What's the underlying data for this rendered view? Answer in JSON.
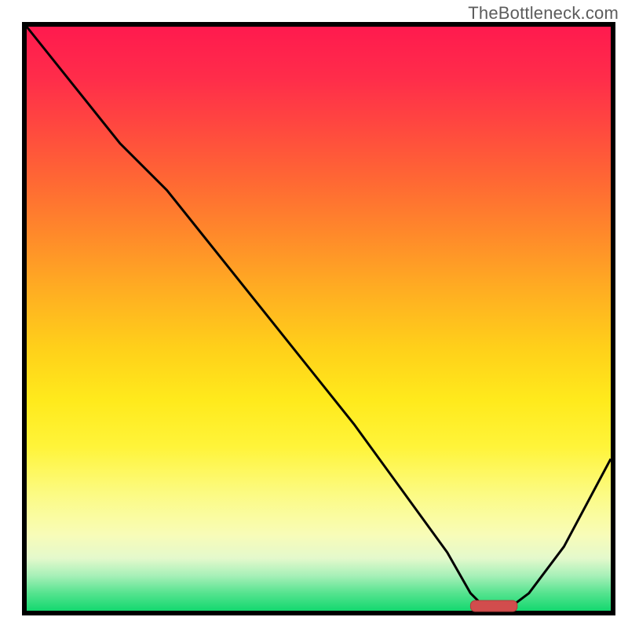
{
  "watermark": "TheBottleneck.com",
  "colors": {
    "border": "#000000",
    "curve": "#000000",
    "marker": "#d14d4d",
    "watermark_text": "#5c5c5c"
  },
  "chart_data": {
    "type": "line",
    "title": "",
    "xlabel": "",
    "ylabel": "",
    "xlim": [
      0,
      100
    ],
    "ylim": [
      0,
      100
    ],
    "grid": false,
    "legend": false,
    "series": [
      {
        "name": "bottleneck-curve",
        "x": [
          0,
          8,
          16,
          24,
          32,
          40,
          48,
          56,
          64,
          72,
          76,
          78,
          80,
          82,
          86,
          92,
          100
        ],
        "y": [
          100,
          90,
          80,
          72,
          62,
          52,
          42,
          32,
          21,
          10,
          3,
          1,
          0,
          0,
          3,
          11,
          26
        ]
      }
    ],
    "minimum_marker": {
      "x_start": 76,
      "x_end": 84,
      "y": 0.8
    },
    "background_gradient_stops": [
      {
        "pos": 0.0,
        "hex": "#ff1a4e"
      },
      {
        "pos": 0.5,
        "hex": "#ffc41d"
      },
      {
        "pos": 0.8,
        "hex": "#fcfb83"
      },
      {
        "pos": 1.0,
        "hex": "#14d86f"
      }
    ]
  }
}
